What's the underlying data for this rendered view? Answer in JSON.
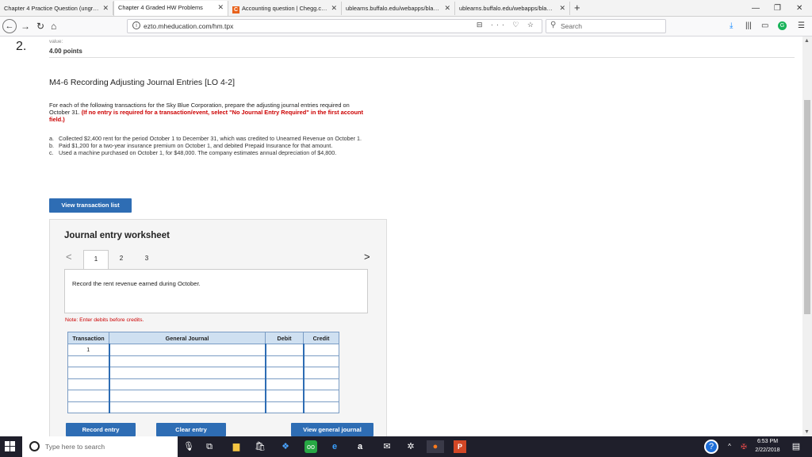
{
  "browser": {
    "tabs": [
      {
        "title": "Chapter 4 Practice Question (ungr…",
        "active": false
      },
      {
        "title": "Chapter 4 Graded HW Problems",
        "active": true
      },
      {
        "title": "Accounting question | Chegg.c…",
        "active": false
      },
      {
        "title": "ublearns.buffalo.edu/webapps/bla…",
        "active": false
      },
      {
        "title": "ublearns.buffalo.edu/webapps/bla…",
        "active": false
      }
    ],
    "url": "ezto.mheducation.com/hm.tpx",
    "url_actions": "⊟ ··· ♡ ☆",
    "search_placeholder": "Search"
  },
  "question": {
    "number": "2.",
    "value_label": "value:",
    "points": "4.00 points",
    "title": "M4-6 Recording Adjusting Journal Entries [LO 4-2]",
    "instruction_text": "For each of the following transactions for the Sky Blue Corporation, prepare the adjusting journal entries required on October 31.",
    "instruction_red": "(If no entry is required for a transaction/event, select \"No Journal Entry Required\" in the first account field.)",
    "transactions": [
      {
        "letter": "a.",
        "text": "Collected $2,400 rent for the period October 1 to December 31, which was credited to Unearned Revenue on October 1."
      },
      {
        "letter": "b.",
        "text": "Paid $1,200 for a two-year insurance premium on October 1, and debited Prepaid Insurance for that amount."
      },
      {
        "letter": "c.",
        "text": "Used a machine purchased on October 1, for $48,000. The company estimates annual depreciation of $4,800."
      }
    ],
    "view_transaction_list": "View transaction list"
  },
  "worksheet": {
    "title": "Journal entry worksheet",
    "pages": [
      "1",
      "2",
      "3"
    ],
    "active_page": "1",
    "prev_arrow": "<",
    "next_arrow": ">",
    "prompt": "Record the rent revenue earned during October.",
    "note": "Note: Enter debits before credits.",
    "columns": [
      "Transaction",
      "General Journal",
      "Debit",
      "Credit"
    ],
    "rows": [
      {
        "transaction": "1",
        "account": "",
        "debit": "",
        "credit": ""
      },
      {
        "transaction": "",
        "account": "",
        "debit": "",
        "credit": ""
      },
      {
        "transaction": "",
        "account": "",
        "debit": "",
        "credit": ""
      },
      {
        "transaction": "",
        "account": "",
        "debit": "",
        "credit": ""
      },
      {
        "transaction": "",
        "account": "",
        "debit": "",
        "credit": ""
      },
      {
        "transaction": "",
        "account": "",
        "debit": "",
        "credit": ""
      }
    ],
    "record_entry": "Record entry",
    "clear_entry": "Clear entry",
    "view_general_journal": "View general journal"
  },
  "taskbar": {
    "search_placeholder": "Type here to search",
    "time": "6:53 PM",
    "date": "2/22/2018"
  },
  "colors": {
    "accent_blue": "#2e6db4",
    "required_red": "#cc0000",
    "table_header": "#cfe0f1"
  }
}
